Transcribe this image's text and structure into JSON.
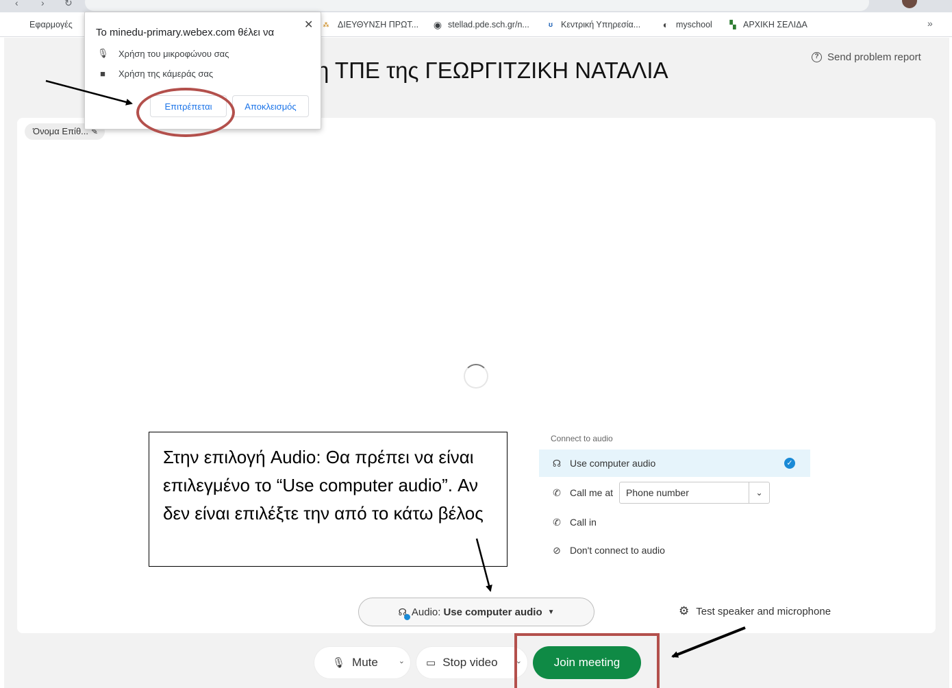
{
  "bookmarks": {
    "apps": "Εφαρμογές",
    "items": [
      "ΔΙΕΥΘΥΝΣΗ ΠΡΩΤ...",
      "stellad.pde.sch.gr/n...",
      "Κεντρική Υπηρεσία...",
      "myschool",
      "ΑΡΧΙΚΗ ΣΕΛΙΔΑ"
    ],
    "more": "»"
  },
  "permission_popup": {
    "question": "Το minedu-primary.webex.com θέλει να",
    "microphone": "Χρήση του μικροφώνου σας",
    "camera": "Χρήση της κάμεράς σας",
    "allow": "Επιτρέπεται",
    "block": "Αποκλεισμός",
    "close": "✕"
  },
  "page": {
    "title": "η ΤΠΕ της ΓΕΩΡΓΙΤΖΙΚΗ ΝΑΤΑΛΙΑ",
    "problem_report": "Send problem report",
    "name_chip": "Όνομα Επίθ..."
  },
  "audio_menu": {
    "header": "Connect to audio",
    "use_computer": "Use computer audio",
    "call_me_at": "Call me at",
    "phone_placeholder": "Phone number",
    "call_in": "Call in",
    "dont_connect": "Don't connect to audio"
  },
  "audio_pill": {
    "label": "Audio:",
    "value": "Use computer audio"
  },
  "test_speaker": "Test speaker and microphone",
  "controls": {
    "mute": "Mute",
    "stop_video": "Stop video",
    "join": "Join meeting"
  },
  "annotation": "Στην επιλογή Audio: Θα πρέπει να είναι επιλεγμένο το “Use computer audio”. Αν δεν είναι επιλέξτε την από το κάτω βέλος",
  "colors": {
    "join": "#0f8a45",
    "selected": "#1a8ad6",
    "highlight": "#b3504c"
  }
}
